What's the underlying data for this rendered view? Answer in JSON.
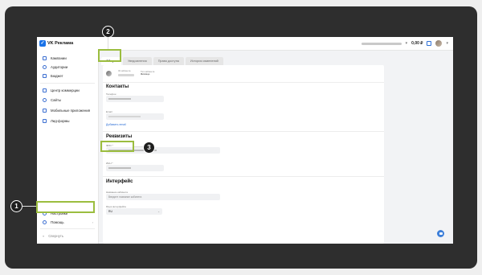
{
  "app": {
    "brand": "VK Реклама"
  },
  "topbar": {
    "balance": "0,00 ₽"
  },
  "sidebar": {
    "items": [
      {
        "label": "Кампании",
        "icon": "campaigns-icon"
      },
      {
        "label": "Аудитории",
        "icon": "audiences-icon"
      },
      {
        "label": "Бюджет",
        "icon": "budget-icon"
      },
      {
        "label": "Центр коммерции",
        "icon": "commerce-icon"
      },
      {
        "label": "Сайты",
        "icon": "sites-icon"
      },
      {
        "label": "Мобильные приложения",
        "icon": "mobile-apps-icon"
      },
      {
        "label": "Лид-формы",
        "icon": "lead-forms-icon"
      }
    ],
    "bottom": [
      {
        "label": "Настройки",
        "icon": "gear-icon"
      },
      {
        "label": "Помощь",
        "icon": "help-icon"
      },
      {
        "label": "Свернуть",
        "icon": "collapse-icon"
      }
    ]
  },
  "tabs": [
    {
      "label": "Общие",
      "active": true
    },
    {
      "label": "Уведомления",
      "active": false
    },
    {
      "label": "Права доступа",
      "active": false
    },
    {
      "label": "История изменений",
      "active": false
    }
  ],
  "cabinet": {
    "id_label": "ID кабинета",
    "type_label": "Тип кабинета",
    "type_value": "Физлицо"
  },
  "contacts": {
    "title": "Контакты",
    "phone_label": "Телефон",
    "email_label": "Email",
    "add_email": "Добавить email"
  },
  "requisites": {
    "title": "Реквизиты",
    "name_label": "ФИО *",
    "inn_label": "ИНН *"
  },
  "interface": {
    "title": "Интерфейс",
    "cabinet_name_label": "Название кабинета",
    "cabinet_name_placeholder": "Введите название кабинета",
    "language_label": "Язык интерфейса",
    "language_value": "RU"
  },
  "callouts": [
    "1",
    "2",
    "3"
  ],
  "colors": {
    "accent": "#2d6fd6",
    "highlight": "#9bbd3f",
    "badge": "#1e1e1e",
    "frame": "#2e2e2e"
  }
}
